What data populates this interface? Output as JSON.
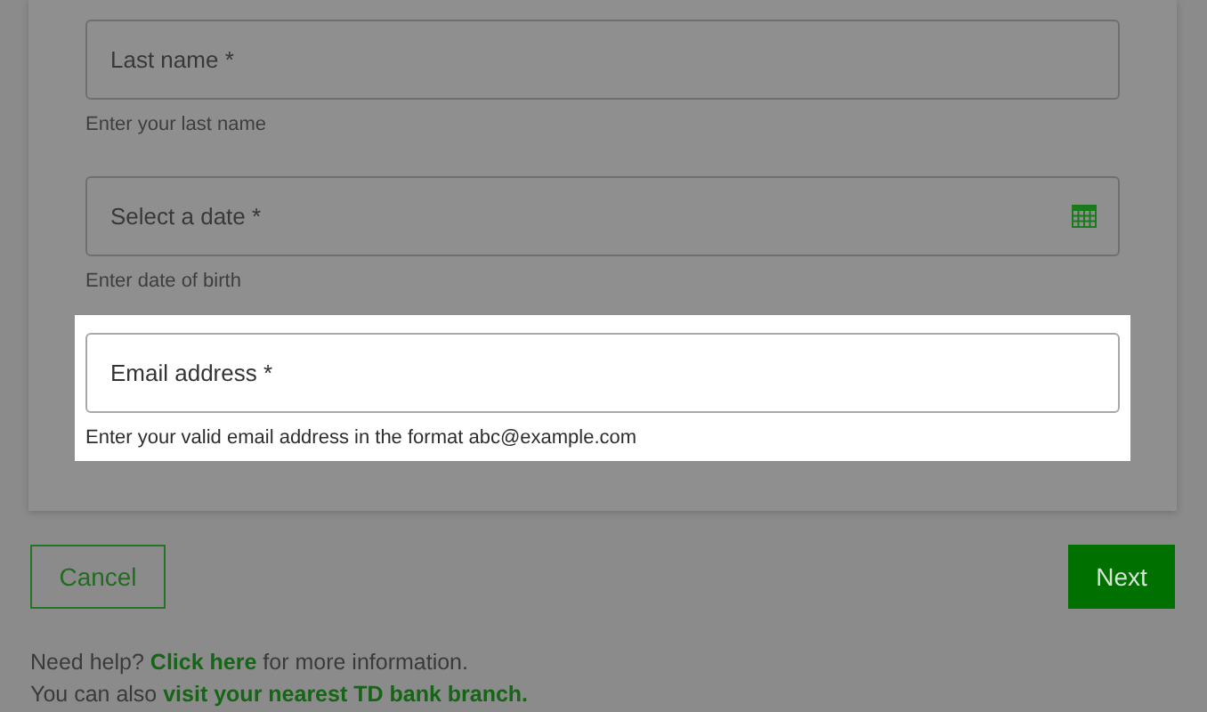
{
  "fields": [
    {
      "label": "Last name *",
      "hint": "Enter your last name",
      "highlighted": false,
      "kind": "text"
    },
    {
      "label": "Select a date *",
      "hint": "Enter date of birth",
      "highlighted": false,
      "kind": "date"
    },
    {
      "label": "Email address *",
      "hint": "Enter your valid email address in the format abc@example.com",
      "highlighted": true,
      "kind": "text"
    }
  ],
  "buttons": {
    "cancel": "Cancel",
    "next": "Next"
  },
  "help": [
    {
      "before": "Need help?",
      "link": "Click here",
      "after": "for more information."
    },
    {
      "before": "You can also",
      "link": "visit your nearest TD bank branch."
    }
  ]
}
